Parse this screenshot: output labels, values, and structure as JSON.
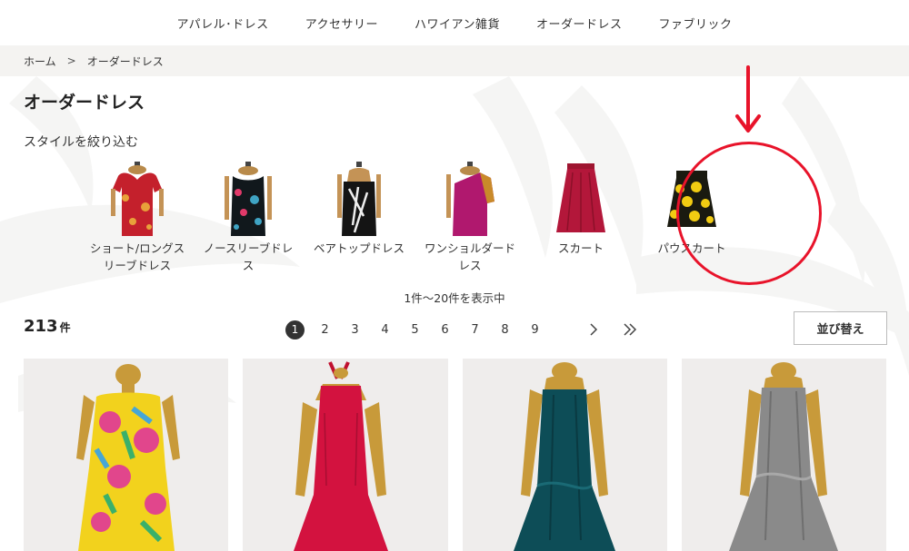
{
  "nav": {
    "items": [
      "アパレル･ドレス",
      "アクセサリー",
      "ハワイアン雑貨",
      "オーダードレス",
      "ファブリック"
    ]
  },
  "breadcrumb": {
    "home": "ホーム",
    "separator": ">",
    "current": "オーダードレス"
  },
  "page": {
    "title": "オーダードレス",
    "filter_label": "スタイルを絞り込む"
  },
  "styles": [
    {
      "name": "ショート/ロングスリーブドレス",
      "icon": "short-long-sleeve-dress-icon"
    },
    {
      "name": "ノースリーブドレス",
      "icon": "sleeveless-dress-icon"
    },
    {
      "name": "ベアトップドレス",
      "icon": "bare-top-dress-icon"
    },
    {
      "name": "ワンショルダードレス",
      "icon": "one-shoulder-dress-icon"
    },
    {
      "name": "スカート",
      "icon": "skirt-icon"
    },
    {
      "name": "パウスカート",
      "icon": "pau-skirt-icon"
    }
  ],
  "results": {
    "range_text": "1件〜20件を表示中",
    "count": "213",
    "count_unit": "件"
  },
  "pagination": {
    "pages": [
      "1",
      "2",
      "3",
      "4",
      "5",
      "6",
      "7",
      "8",
      "9"
    ],
    "current": "1",
    "next_icon": "chevron-right-icon",
    "last_icon": "double-chevron-right-icon"
  },
  "sort": {
    "label": "並び替え"
  },
  "products": [
    {
      "name": "yellow-floral-halter-dress",
      "color": "#f2d21d"
    },
    {
      "name": "red-halter-mermaid-dress",
      "color": "#d3123f"
    },
    {
      "name": "teal-bare-top-dress",
      "color": "#0d4d57"
    },
    {
      "name": "silver-bare-top-dress",
      "color": "#8a8a8a"
    }
  ],
  "colors": {
    "accent_annotation": "#e8132a",
    "breadcrumb_bg": "#f4f3f1",
    "pager_active": "#333333"
  }
}
